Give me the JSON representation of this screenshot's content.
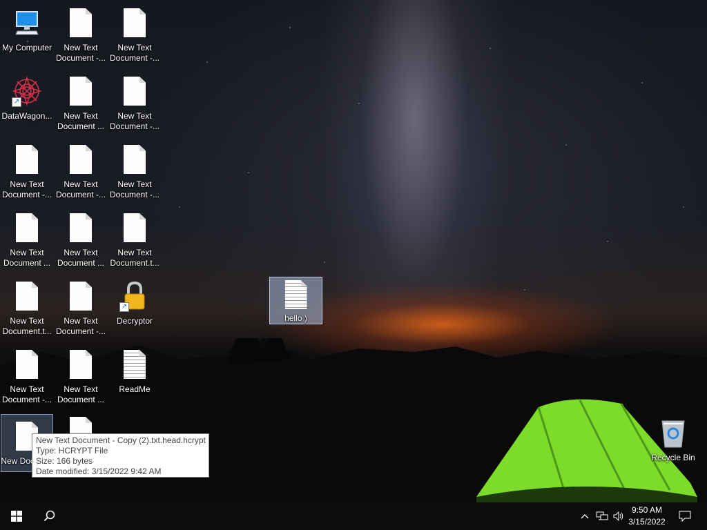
{
  "desktop": {
    "icons": [
      {
        "id": "my-computer",
        "label": "My Computer",
        "type": "computer"
      },
      {
        "id": "c2r1",
        "label": "New Text Document -...",
        "type": "doc"
      },
      {
        "id": "c3r1",
        "label": "New Text Document -...",
        "type": "doc"
      },
      {
        "id": "datawagon",
        "label": "DataWagon...",
        "type": "app-shortcut"
      },
      {
        "id": "c2r2",
        "label": "New Text Document ...",
        "type": "doc"
      },
      {
        "id": "c3r2",
        "label": "New Text Document -...",
        "type": "doc"
      },
      {
        "id": "c1r3",
        "label": "New Text Document -...",
        "type": "doc"
      },
      {
        "id": "c2r3",
        "label": "New Text Document -...",
        "type": "doc"
      },
      {
        "id": "c3r3",
        "label": "New Text Document -...",
        "type": "doc"
      },
      {
        "id": "c1r4",
        "label": "New Text Document ...",
        "type": "doc"
      },
      {
        "id": "c2r4",
        "label": "New Text Document ...",
        "type": "doc"
      },
      {
        "id": "c3r4",
        "label": "New Text Document.t...",
        "type": "doc"
      },
      {
        "id": "c1r5",
        "label": "New Text Document.t...",
        "type": "doc"
      },
      {
        "id": "c2r5",
        "label": "New Text Document -...",
        "type": "doc"
      },
      {
        "id": "decryptor",
        "label": "Decryptor",
        "type": "lock-shortcut"
      },
      {
        "id": "c1r6",
        "label": "New Text Document -...",
        "type": "doc"
      },
      {
        "id": "c2r6",
        "label": "New Text Document ...",
        "type": "doc"
      },
      {
        "id": "readme",
        "label": "ReadMe",
        "type": "lined-doc"
      },
      {
        "id": "c1r7",
        "label": "New Docum...",
        "type": "doc",
        "selected": true
      },
      {
        "id": "c2r7",
        "label": "",
        "type": "doc"
      },
      {
        "id": "hello",
        "label": "hello )",
        "type": "doc",
        "dragging": true
      },
      {
        "id": "recycle",
        "label": "Recycle Bin",
        "type": "recycle"
      }
    ]
  },
  "tooltip": {
    "name": "New Text Document - Copy (2).txt.head.hcrypt",
    "type_line": "Type: HCRYPT File",
    "size_line": "Size: 166 bytes",
    "modified_line": "Date modified: 3/15/2022 9:42 AM"
  },
  "taskbar": {
    "start_icon": "windows-logo-icon",
    "search_icon": "search-icon",
    "tray_icons": [
      "chevron-up-icon",
      "network-icon",
      "volume-icon"
    ],
    "time": "9:50 AM",
    "date": "3/15/2022",
    "notification_icon": "notification-icon"
  }
}
